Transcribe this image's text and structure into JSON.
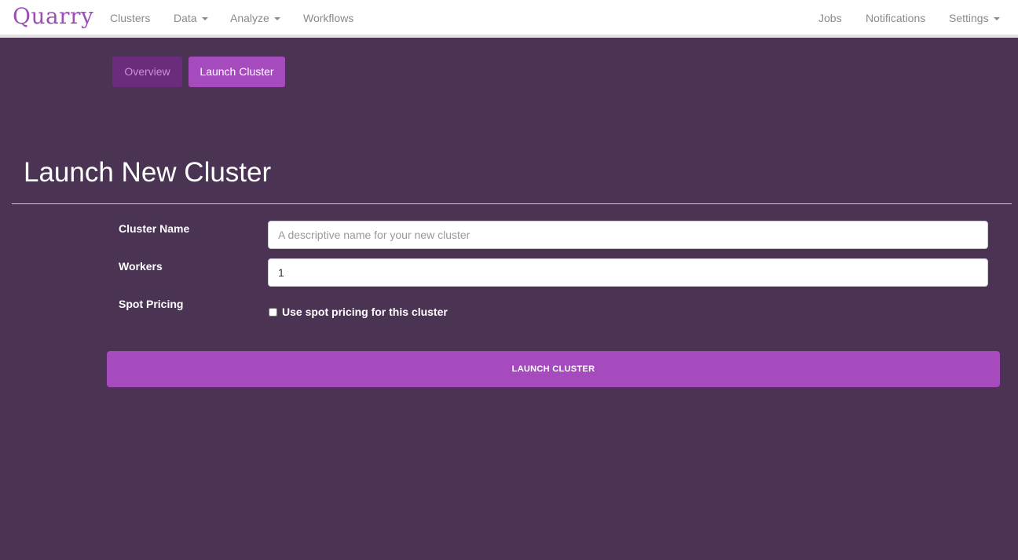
{
  "navbar": {
    "brand": "Quarry",
    "left_items": [
      {
        "label": "Clusters"
      },
      {
        "label": "Data"
      },
      {
        "label": "Analyze"
      },
      {
        "label": "Workflows"
      }
    ],
    "right_items": [
      {
        "label": "Jobs"
      },
      {
        "label": "Notifications"
      },
      {
        "label": "Settings"
      }
    ]
  },
  "subnav": {
    "tabs": [
      {
        "label": "Overview",
        "active": false
      },
      {
        "label": "Launch Cluster",
        "active": true
      }
    ]
  },
  "page": {
    "title": "Launch New Cluster"
  },
  "form": {
    "cluster_name": {
      "label": "Cluster Name",
      "value": "",
      "placeholder": "A descriptive name for your new cluster"
    },
    "workers": {
      "label": "Workers",
      "value": "1"
    },
    "spot_pricing": {
      "label": "Spot Pricing",
      "checkbox_label": "Use spot pricing for this cluster",
      "checked": false
    },
    "submit_label": "LAUNCH CLUSTER"
  },
  "colors": {
    "background": "#4b3353",
    "brand": "#9b4fb4",
    "accent": "#a54bbd",
    "tab_inactive": "#6b2c7d"
  }
}
